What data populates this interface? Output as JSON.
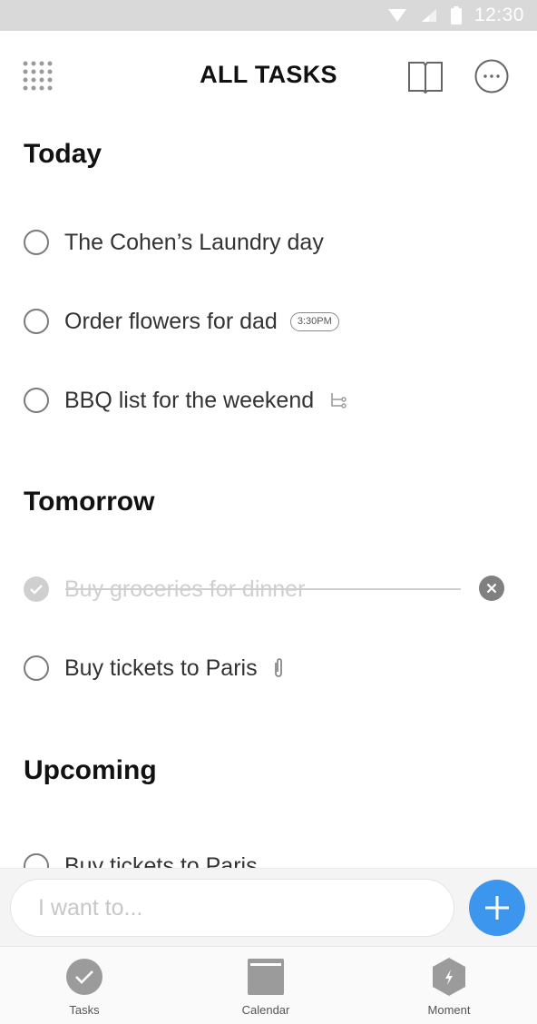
{
  "status_bar": {
    "time": "12:30"
  },
  "header": {
    "title": "ALL TASKS"
  },
  "sections": {
    "today": {
      "title": "Today",
      "tasks": [
        {
          "label": "The Cohen’s Laundry day"
        },
        {
          "label": "Order flowers for dad",
          "badge": "3:30PM"
        },
        {
          "label": "BBQ list for the weekend",
          "icon": "subtask-icon"
        }
      ]
    },
    "tomorrow": {
      "title": "Tomorrow",
      "tasks": [
        {
          "label": "Buy groceries for dinner",
          "completed": true
        },
        {
          "label": "Buy tickets to Paris",
          "icon": "paperclip-icon"
        }
      ]
    },
    "upcoming": {
      "title": "Upcoming",
      "tasks": [
        {
          "label": "Buy tickets to Paris"
        }
      ]
    }
  },
  "input": {
    "placeholder": "I want to..."
  },
  "bottom_nav": {
    "items": [
      {
        "label": "Tasks",
        "icon": "check-circle-icon"
      },
      {
        "label": "Calendar",
        "icon": "calendar-icon"
      },
      {
        "label": "Moment",
        "icon": "lightning-hexagon-icon"
      }
    ]
  },
  "colors": {
    "accent": "#3d96ee",
    "completed_gray": "#cfcfcf",
    "status_bar": "#d9d9d9"
  }
}
